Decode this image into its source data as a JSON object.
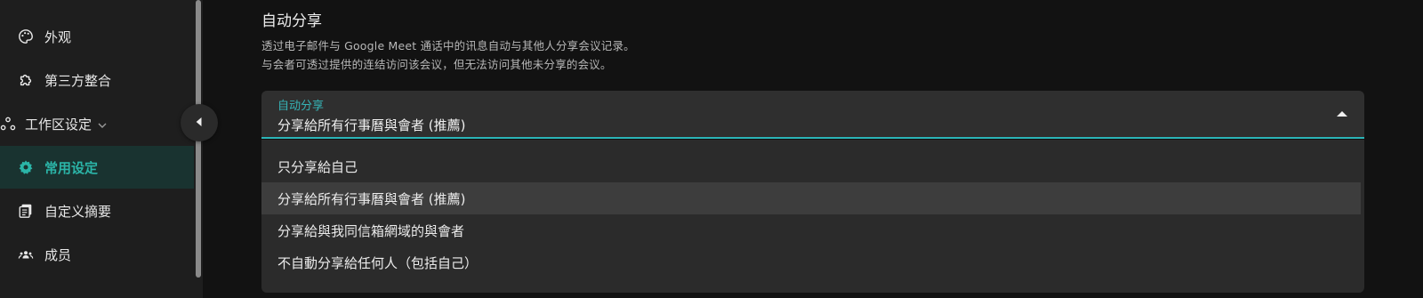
{
  "sidebar": {
    "items": [
      {
        "label": "外观",
        "icon": "palette-icon"
      },
      {
        "label": "第三方整合",
        "icon": "puzzle-icon"
      },
      {
        "label": "工作区设定",
        "icon": "workspace-icon"
      },
      {
        "label": "常用设定",
        "icon": "gear-icon",
        "active": true
      },
      {
        "label": "自定义摘要",
        "icon": "summary-icon"
      },
      {
        "label": "成员",
        "icon": "members-icon"
      }
    ]
  },
  "section": {
    "title": "自动分享",
    "desc_line1": "透过电子邮件与 Google Meet 通话中的讯息自动与其他人分享会议记录。",
    "desc_line2": "与会者可透过提供的连结访问该会议，但无法访问其他未分享的会议。"
  },
  "select": {
    "label": "自动分享",
    "value": "分享給所有行事曆與會者 (推薦)"
  },
  "menu": {
    "options": [
      "只分享給自己",
      "分享給所有行事曆與會者 (推薦)",
      "分享給與我同信箱網域的與會者",
      "不自動分享給任何人（包括自己）"
    ]
  },
  "colors": {
    "accent": "#2bb5b8",
    "active_bg": "#193330"
  }
}
